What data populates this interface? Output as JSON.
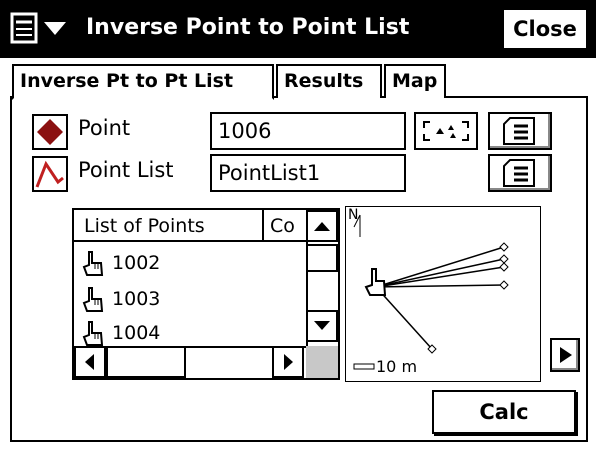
{
  "app": {
    "title": "Inverse Point to Point List",
    "close_label": "Close"
  },
  "tabs": [
    {
      "label": "Inverse Pt to Pt List",
      "active": true
    },
    {
      "label": "Results",
      "active": false
    },
    {
      "label": "Map",
      "active": false
    }
  ],
  "form": {
    "point_label": "Point",
    "point_value": "1006",
    "point_list_label": "Point List",
    "point_list_value": "PointList1"
  },
  "list": {
    "headers": [
      "List of Points",
      "Co"
    ],
    "items": [
      "1002",
      "1003",
      "1004"
    ]
  },
  "map": {
    "north_label": "N",
    "scale_label": "10 m"
  },
  "actions": {
    "calc_label": "Calc"
  },
  "colors": {
    "point_icon": "#8b1010",
    "polyline_icon": "#c02020",
    "titlebar": "#000000"
  },
  "icons": [
    "menu-icon",
    "dropdown-arrow-icon",
    "point-icon",
    "polyline-icon",
    "select-from-map-icon",
    "list-icon",
    "hand-pointer-icon",
    "scroll-up-icon",
    "scroll-down-icon",
    "scroll-left-icon",
    "scroll-right-icon",
    "play-arrow-icon"
  ]
}
